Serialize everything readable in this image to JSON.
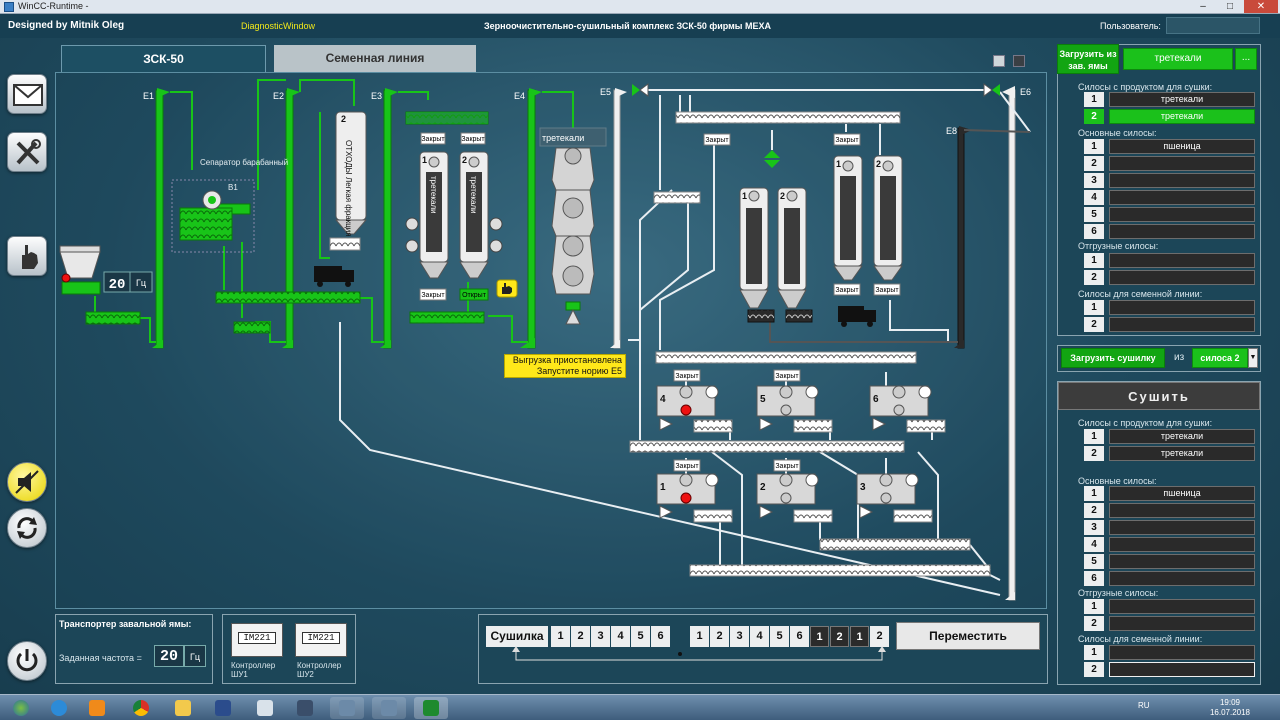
{
  "window": {
    "title": "WinCC-Runtime -",
    "minimize": "–",
    "maximize": "□",
    "close": "✕"
  },
  "header": {
    "designer": "Designed by Mitnik Oleg",
    "diagnostic": "DiagnosticWindow",
    "title": "Зерноочистительно-сушильный комплекс ЗСК-50 фирмы МЕХА",
    "user_label": "Пользователь:",
    "user_value": ""
  },
  "tabs": [
    {
      "label": "ЗСК-50",
      "active": true
    },
    {
      "label": "Семенная линия",
      "active": false
    }
  ],
  "rail_icons": [
    "mail-icon",
    "tools-icon",
    "hand-icon",
    "mute-icon",
    "refresh-icon",
    "power-icon"
  ],
  "schematic": {
    "elevators": [
      "E1",
      "E2",
      "E3",
      "E4",
      "E5",
      "E6",
      "E8"
    ],
    "separator": "Сепаратор барабанный",
    "separator_id": "B1",
    "freq_value": "20",
    "freq_unit": "Гц",
    "silo_waste_num": "2",
    "silo_waste_text": "ОТХОДЫ Легкая фракция",
    "silo_left_1": {
      "num": "1",
      "text": "третекали"
    },
    "silo_left_2": {
      "num": "2",
      "text": "третекали"
    },
    "dryer_label": "третекали",
    "closed": "Закрыт",
    "open": "Открыт",
    "warning_line1": "Выгрузка приостановлена",
    "warning_line2": "Запустите норию Е5",
    "right_silos": [
      "1",
      "2",
      "1",
      "2"
    ],
    "bins_top": [
      "4",
      "5",
      "6"
    ],
    "bins_bottom": [
      "1",
      "2",
      "3"
    ]
  },
  "transporter": {
    "title": "Транспортер завальной ямы:",
    "freq_label": "Заданная частота =",
    "freq_value": "20",
    "freq_unit": "Гц"
  },
  "controllers": [
    {
      "model": "IM221",
      "label": "Контроллер ШУ1"
    },
    {
      "model": "IM221",
      "label": "Контроллер ШУ2"
    }
  ],
  "route": {
    "label": "Сушилка",
    "left_nums": [
      "1",
      "2",
      "3",
      "4",
      "5",
      "6"
    ],
    "right_nums": [
      "1",
      "2",
      "3",
      "4",
      "5",
      "6",
      "1",
      "2",
      "1",
      "2"
    ],
    "move_button": "Переместить"
  },
  "load_pit": {
    "button": "Загрузить из зав. ямы",
    "product": "третекали",
    "more": "...",
    "silos_product_label": "Силосы с продуктом для сушки:",
    "silos_product": [
      {
        "n": "1",
        "v": "третекали",
        "active": false
      },
      {
        "n": "2",
        "v": "третекали",
        "active": true
      }
    ],
    "main_silos_label": "Основные силосы:",
    "main_silos": [
      {
        "n": "1",
        "v": "пшеница"
      },
      {
        "n": "2",
        "v": ""
      },
      {
        "n": "3",
        "v": ""
      },
      {
        "n": "4",
        "v": ""
      },
      {
        "n": "5",
        "v": ""
      },
      {
        "n": "6",
        "v": ""
      }
    ],
    "ship_silos_label": "Отгрузные силосы:",
    "ship_silos": [
      {
        "n": "1",
        "v": ""
      },
      {
        "n": "2",
        "v": ""
      }
    ],
    "seed_silos_label": "Силосы для семенной линии:",
    "seed_silos": [
      {
        "n": "1",
        "v": ""
      },
      {
        "n": "2",
        "v": ""
      }
    ]
  },
  "load_dryer": {
    "button": "Загрузить сушилку",
    "from": "из",
    "source": "силоса 2"
  },
  "dry_panel": {
    "title": "Сушить",
    "silos_product_label": "Силосы с продуктом для сушки:",
    "silos_product": [
      {
        "n": "1",
        "v": "третекали"
      },
      {
        "n": "2",
        "v": "третекали"
      }
    ],
    "main_silos_label": "Основные силосы:",
    "main_silos": [
      {
        "n": "1",
        "v": "пшеница"
      },
      {
        "n": "2",
        "v": ""
      },
      {
        "n": "3",
        "v": ""
      },
      {
        "n": "4",
        "v": ""
      },
      {
        "n": "5",
        "v": ""
      },
      {
        "n": "6",
        "v": ""
      }
    ],
    "ship_silos_label": "Отгрузные силосы:",
    "ship_silos": [
      {
        "n": "1",
        "v": ""
      },
      {
        "n": "2",
        "v": ""
      }
    ],
    "seed_silos_label": "Силосы для семенной линии:",
    "seed_silos": [
      {
        "n": "1",
        "v": ""
      },
      {
        "n": "2",
        "v": ""
      }
    ]
  },
  "taskbar": {
    "lang": "RU",
    "time": "19:09",
    "date": "16.07.2018"
  },
  "colors": {
    "active_green": "#18c418",
    "pipe_white": "#e8eef2",
    "warning_yellow": "#ffe81a"
  }
}
